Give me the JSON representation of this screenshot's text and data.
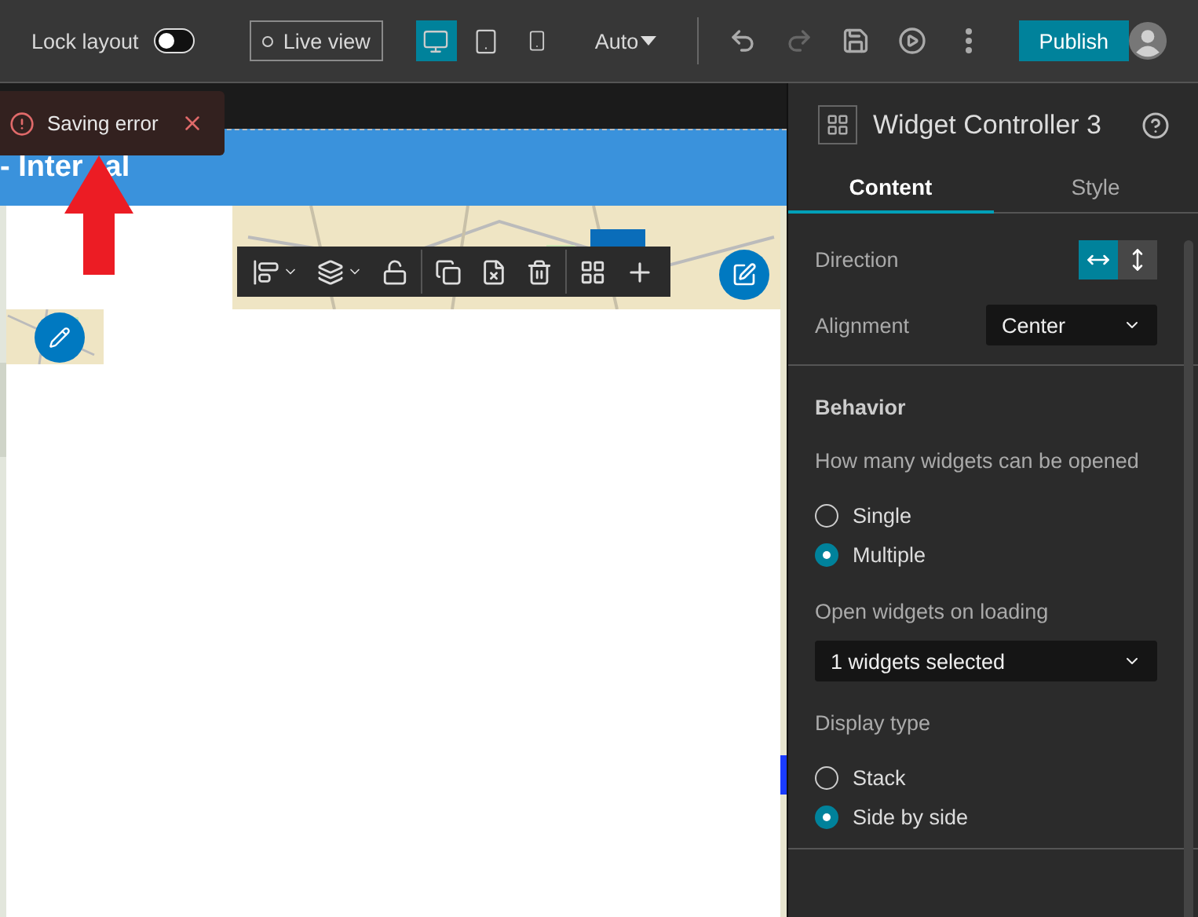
{
  "topbar": {
    "lock_layout": {
      "label": "Lock layout",
      "on": false
    },
    "live_view": {
      "label": "Live view"
    },
    "devices": [
      {
        "kind": "desktop",
        "selected": true
      },
      {
        "kind": "tablet",
        "selected": false
      },
      {
        "kind": "phone",
        "selected": false
      }
    ],
    "size_menu": {
      "label": "Auto"
    },
    "tools": [
      {
        "kind": "undo",
        "disabled": false
      },
      {
        "kind": "redo",
        "disabled": true
      },
      {
        "kind": "save",
        "disabled": false
      },
      {
        "kind": "preview",
        "disabled": false
      },
      {
        "kind": "more",
        "disabled": false
      }
    ],
    "publish": "Publish"
  },
  "canvas": {
    "header_title": [
      "- Inter",
      "al"
    ],
    "toast": {
      "message": "Saving error"
    }
  },
  "panel": {
    "title": "Widget Controller 3",
    "tabs": [
      {
        "label": "Content",
        "selected": true
      },
      {
        "label": "Style",
        "selected": false
      }
    ],
    "direction": {
      "label": "Direction",
      "options": [
        {
          "kind": "horizontal",
          "selected": true
        },
        {
          "kind": "vertical",
          "selected": false
        }
      ]
    },
    "alignment": {
      "label": "Alignment",
      "value": "Center"
    },
    "behavior": {
      "heading": "Behavior",
      "open_count": {
        "label": "How many widgets can be opened",
        "options": [
          {
            "label": "Single",
            "selected": false
          },
          {
            "label": "Multiple",
            "selected": true
          }
        ]
      },
      "open_on_loading": {
        "label": "Open widgets on loading",
        "value": "1 widgets selected"
      },
      "display_type": {
        "label": "Display type",
        "options": [
          {
            "label": "Stack",
            "selected": false
          },
          {
            "label": "Side by side",
            "selected": true
          }
        ]
      }
    }
  }
}
